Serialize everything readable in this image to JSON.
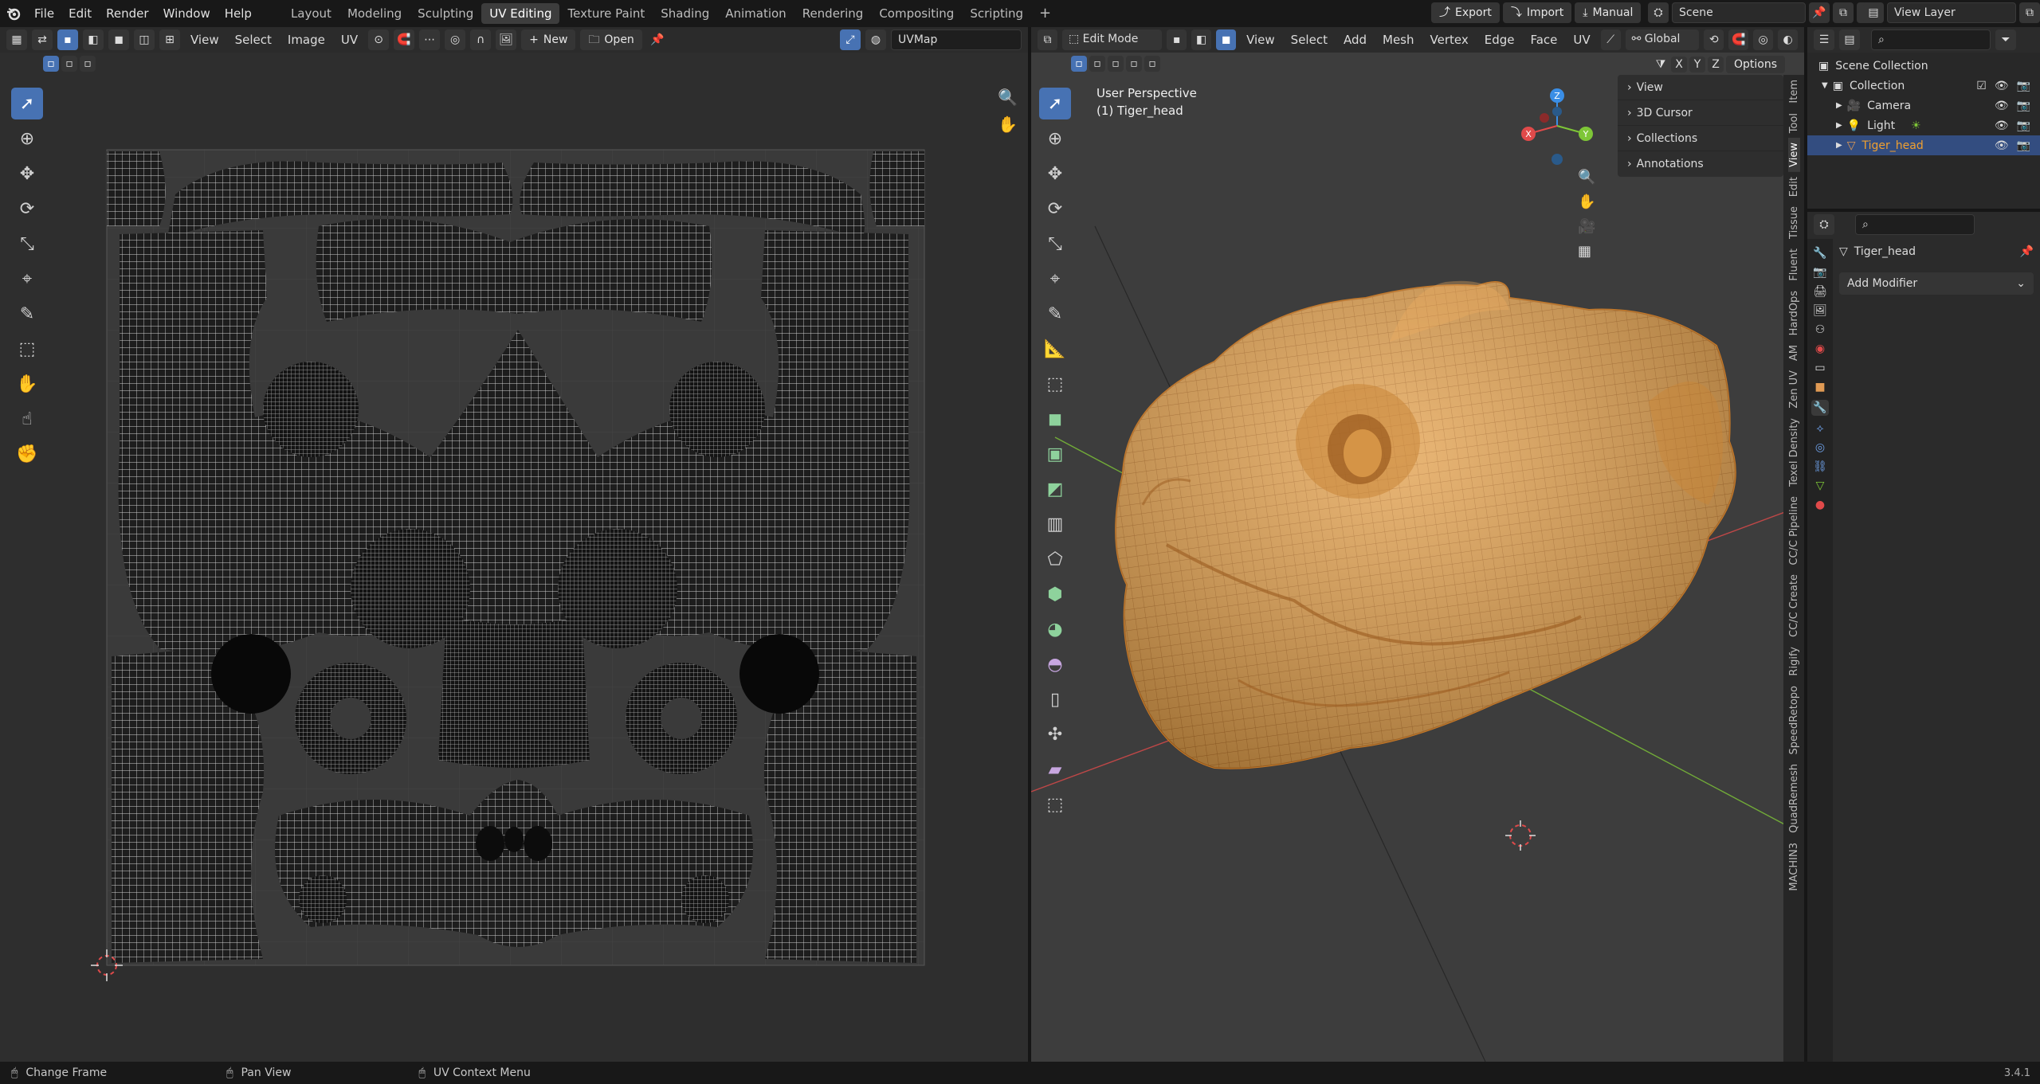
{
  "topbar": {
    "menus": [
      "File",
      "Edit",
      "Render",
      "Window",
      "Help"
    ],
    "workspaces": [
      "Layout",
      "Modeling",
      "Sculpting",
      "UV Editing",
      "Texture Paint",
      "Shading",
      "Animation",
      "Rendering",
      "Compositing",
      "Scripting"
    ],
    "active_workspace": "UV Editing",
    "add_tab": "+",
    "export_label": "Export",
    "import_label": "Import",
    "manual_label": "Manual",
    "scene_name": "Scene",
    "view_layer": "View Layer"
  },
  "uv_editor": {
    "menus": [
      "View",
      "Select",
      "Image",
      "UV"
    ],
    "new_label": "New",
    "open_label": "Open",
    "uvmap_name": "UVMap"
  },
  "viewport": {
    "mode": "Edit Mode",
    "menus": [
      "View",
      "Select",
      "Add",
      "Mesh",
      "Vertex",
      "Edge",
      "Face",
      "UV"
    ],
    "orientation": "Global",
    "axes": [
      "X",
      "Y",
      "Z"
    ],
    "options_label": "Options",
    "overlay_title": "User Perspective",
    "overlay_object": "(1) Tiger_head",
    "gizmo_axes": {
      "x": "X",
      "y": "Y",
      "z": "Z"
    },
    "npanel_sections": [
      "View",
      "3D Cursor",
      "Collections",
      "Annotations"
    ],
    "npanel_tabs": [
      "Item",
      "Tool",
      "View",
      "Edit",
      "Tissue",
      "Fluent",
      "HardOps",
      "AM",
      "Zen UV",
      "Texel Density",
      "CC/C Pipeline",
      "CC/C Create",
      "Rigify",
      "SpeedRetopo",
      "QuadRemesh",
      "MACHIN3"
    ]
  },
  "outliner": {
    "root": "Scene Collection",
    "collection": "Collection",
    "items": [
      {
        "name": "Camera",
        "selected": false
      },
      {
        "name": "Light",
        "selected": false
      },
      {
        "name": "Tiger_head",
        "selected": true
      }
    ]
  },
  "properties": {
    "object_name": "Tiger_head",
    "add_modifier_label": "Add Modifier"
  },
  "statusbar": {
    "items": [
      "Change Frame",
      "Pan View",
      "UV Context Menu"
    ],
    "version": "3.4.1"
  },
  "colors": {
    "accent": "#4772b3",
    "mesh_orange": "#e8a050",
    "selected_text": "#f0a030",
    "axis_x": "#e04a4a",
    "axis_y": "#7ec637",
    "axis_z": "#3a8ee6"
  }
}
